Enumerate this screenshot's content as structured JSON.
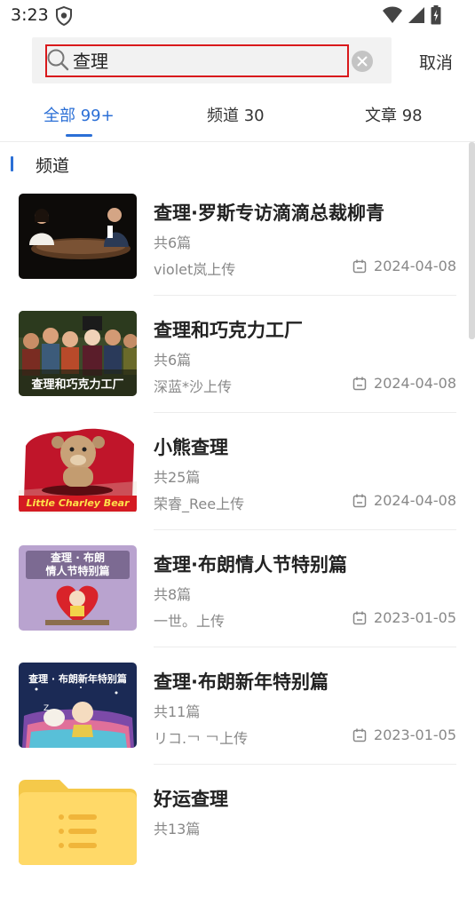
{
  "status_bar": {
    "time": "3:23"
  },
  "search": {
    "value": "查理",
    "cancel_label": "取消"
  },
  "tabs": [
    {
      "label": "全部 99+",
      "active": true
    },
    {
      "label": "频道 30",
      "active": false
    },
    {
      "label": "文章 98",
      "active": false
    }
  ],
  "section": {
    "title": "频道"
  },
  "items": [
    {
      "title": "查理·罗斯专访滴滴总裁柳青",
      "count": "共6篇",
      "uploader": "violet岚上传",
      "date": "2024-04-08"
    },
    {
      "title": "查理和巧克力工厂",
      "count": "共6篇",
      "uploader": "深蓝*沙上传",
      "date": "2024-04-08",
      "thumb_caption": "查理和巧克力工厂"
    },
    {
      "title": "小熊查理",
      "count": "共25篇",
      "uploader": "荣睿_Ree上传",
      "date": "2024-04-08",
      "thumb_caption": "Little Charley Bear"
    },
    {
      "title": "查理·布朗情人节特别篇",
      "count": "共8篇",
      "uploader": "一世。上传",
      "date": "2023-01-05",
      "thumb_caption": "查理 · 布朗\n情人节特别篇"
    },
    {
      "title": "查理·布朗新年特别篇",
      "count": "共11篇",
      "uploader": "リコ.￢ ￢上传",
      "date": "2023-01-05",
      "thumb_caption": "查理 · 布朗新年特别篇"
    },
    {
      "title": "好运查理",
      "count": "共13篇"
    }
  ],
  "colors": {
    "accent": "#2b6fd6",
    "highlight_border": "#d9191c"
  }
}
